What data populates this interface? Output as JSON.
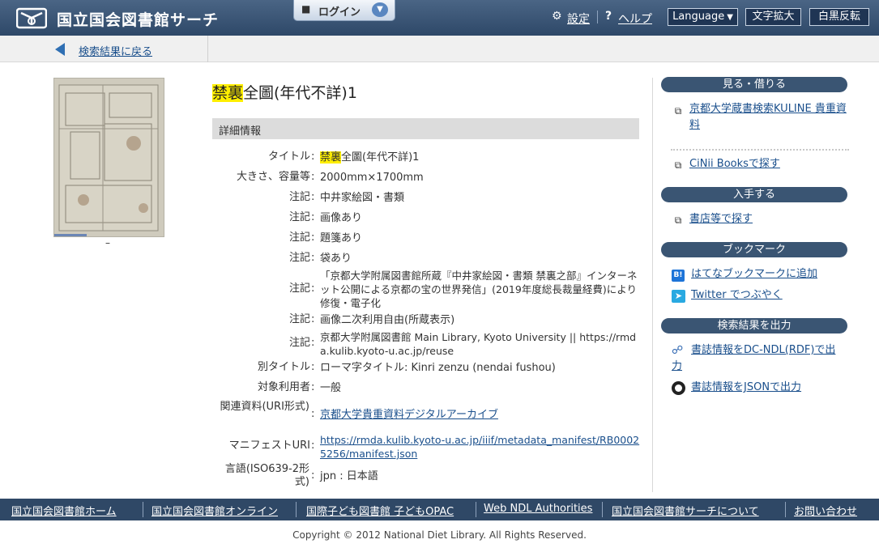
{
  "header": {
    "site_title": "国立国会図書館サーチ",
    "login_label": "ログイン",
    "settings_label": "設定",
    "help_label": "ヘルプ",
    "language_label": "Language",
    "text_enlarge_label": "文字拡大",
    "invert_label": "白黒反転"
  },
  "backbar": {
    "back_label": "検索結果に戻る"
  },
  "thumbnail": {
    "caption": "–"
  },
  "record": {
    "title_highlight": "禁裏",
    "title_rest": "全圖(年代不詳)1",
    "section_title": "詳細情報",
    "fields": [
      {
        "label": "タイトル",
        "value_highlight": "禁裏",
        "value": "全圖(年代不詳)1"
      },
      {
        "label": "大きさ、容量等",
        "value": "2000mm×1700mm"
      },
      {
        "label": "注記",
        "value": "中井家絵図・書類"
      },
      {
        "label": "注記",
        "value": "画像あり"
      },
      {
        "label": "注記",
        "value": "題箋あり"
      },
      {
        "label": "注記",
        "value": "袋あり"
      },
      {
        "label": "注記",
        "value": "「京都大学附属図書館所蔵『中井家絵図・書類 禁裏之部』インターネット公開による京都の宝の世界発信」(2019年度総長裁量経費)により修復・電子化"
      },
      {
        "label": "注記",
        "value": "画像二次利用自由(所蔵表示)"
      },
      {
        "label": "注記",
        "value": "京都大学附属図書館 Main Library, Kyoto University || https://rmda.kulib.kyoto-u.ac.jp/reuse"
      },
      {
        "label": "別タイトル",
        "value": "ローマ字タイトル: Kinri zenzu (nendai fushou)"
      },
      {
        "label": "対象利用者",
        "value": "一般"
      },
      {
        "label": "関連資料(URI形式)",
        "value": "京都大学貴重資料デジタルアーカイブ"
      },
      {
        "label": "マニフェストURI",
        "value": "https://rmda.kulib.kyoto-u.ac.jp/iiif/metadata_manifest/RB00025256/manifest.json"
      },
      {
        "label": "言語(ISO639-2形式)",
        "value": "jpn : 日本語"
      }
    ]
  },
  "sidebar": {
    "view_borrow_heading": "見る・借りる",
    "kuline_link": "京都大学蔵書検索KULINE 貴重資料",
    "cinii_link": "CiNii Booksで探す",
    "obtain_heading": "入手する",
    "store_link": "書店等で探す",
    "bookmark_heading": "ブックマーク",
    "hatena_icon_text": "B!",
    "hatena_link": "はてなブックマークに追加",
    "twitter_link": "Twitter でつぶやく",
    "export_heading": "検索結果を出力",
    "rdf_link": "書誌情報をDC-NDL(RDF)で出力",
    "json_link": "書誌情報をJSONで出力"
  },
  "footer": {
    "nav": [
      "国立国会図書館ホーム",
      "国立国会図書館オンライン",
      "国際子ども図書館 子どもOPAC",
      "Web NDL Authorities",
      "国立国会図書館サーチについて",
      "お問い合わせ"
    ],
    "copyright": "Copyright © 2012 National Diet Library. All Rights Reserved."
  },
  "colors": {
    "header_bg": "#2e4868",
    "link": "#1a4f8c",
    "highlight": "#ffee00",
    "sidebar_heading": "#3a5573"
  }
}
